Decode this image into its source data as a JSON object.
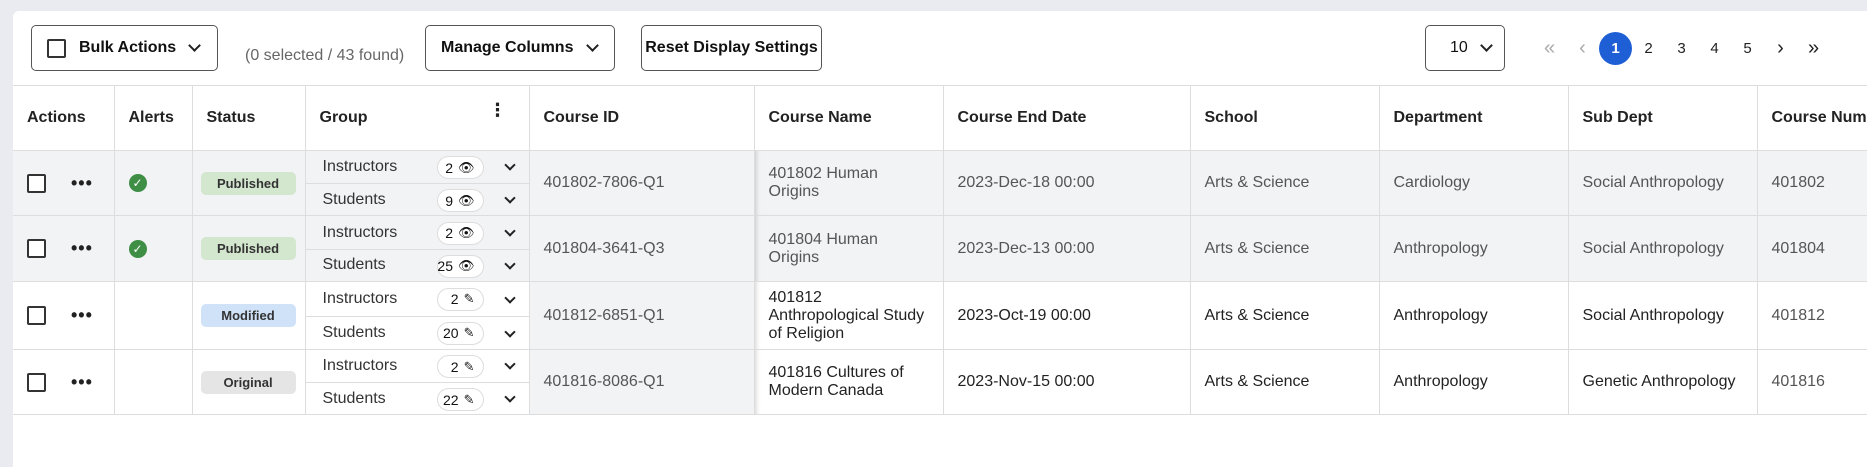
{
  "toolbar": {
    "bulk_actions": "Bulk Actions",
    "found_text": "(0 selected / 43 found)",
    "manage_columns": "Manage Columns",
    "reset_display": "Reset Display Settings",
    "page_size": "10"
  },
  "pager": {
    "first": "«",
    "prev": "‹",
    "pages": [
      "1",
      "2",
      "3",
      "4",
      "5"
    ],
    "active": "1",
    "next": "›",
    "last": "»"
  },
  "columns": [
    "Actions",
    "Alerts",
    "Status",
    "Group",
    "Course ID",
    "Course Name",
    "Course End Date",
    "School",
    "Department",
    "Sub Dept",
    "Course Numl"
  ],
  "rows": [
    {
      "alert": true,
      "status": "Published",
      "status_kind": "pub",
      "instructors_label": "Instructors",
      "instructors_count": "2",
      "students_label": "Students",
      "students_count": "9",
      "group_icon": "eye-icon",
      "course_id": "401802-7806-Q1",
      "course_name": "401802 Human Origins",
      "end_date": "2023-Dec-18 00:00",
      "school": "Arts & Science",
      "department": "Cardiology",
      "sub_dept": "Social Anthropology",
      "course_num": "401802"
    },
    {
      "alert": true,
      "status": "Published",
      "status_kind": "pub",
      "instructors_label": "Instructors",
      "instructors_count": "2",
      "students_label": "Students",
      "students_count": "25",
      "group_icon": "eye-icon",
      "course_id": "401804-3641-Q3",
      "course_name": "401804 Human Origins",
      "end_date": "2023-Dec-13 00:00",
      "school": "Arts & Science",
      "department": "Anthropology",
      "sub_dept": "Social Anthropology",
      "course_num": "401804"
    },
    {
      "alert": false,
      "status": "Modified",
      "status_kind": "mod",
      "instructors_label": "Instructors",
      "instructors_count": "2",
      "students_label": "Students",
      "students_count": "20",
      "group_icon": "pencil-icon",
      "course_id": "401812-6851-Q1",
      "course_name": "401812 Anthropological Study of Religion",
      "end_date": "2023-Oct-19 00:00",
      "school": "Arts & Science",
      "department": "Anthropology",
      "sub_dept": "Social Anthropology",
      "course_num": "401812"
    },
    {
      "alert": false,
      "status": "Original",
      "status_kind": "orig",
      "instructors_label": "Instructors",
      "instructors_count": "2",
      "students_label": "Students",
      "students_count": "22",
      "group_icon": "pencil-icon",
      "course_id": "401816-8086-Q1",
      "course_name": "401816 Cultures of Modern Canada",
      "end_date": "2023-Nov-15 00:00",
      "school": "Arts & Science",
      "department": "Anthropology",
      "sub_dept": "Genetic Anthropology",
      "course_num": "401816"
    }
  ]
}
